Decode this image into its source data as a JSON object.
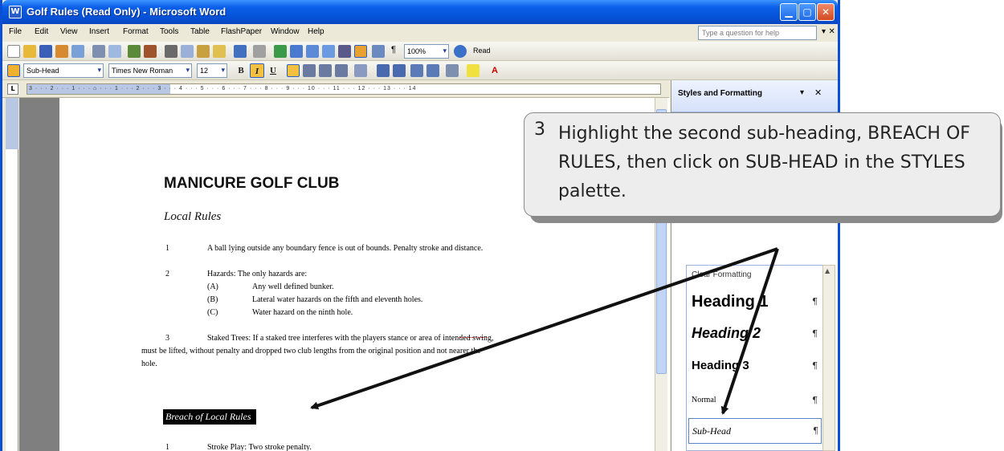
{
  "window": {
    "title": "Golf Rules (Read Only) - Microsoft Word",
    "icon_glyph": "W"
  },
  "menu": {
    "items": [
      "File",
      "Edit",
      "View",
      "Insert",
      "Format",
      "Tools",
      "Table",
      "FlashPaper",
      "Window",
      "Help"
    ],
    "help_placeholder": "Type a question for help"
  },
  "standard_toolbar": {
    "zoom": "100%",
    "read_label": "Read"
  },
  "formatting_toolbar": {
    "style": "Sub-Head",
    "font": "Times New Roman",
    "size": "12",
    "bold": "B",
    "italic": "I",
    "underline": "U",
    "font_color_label": "A"
  },
  "ruler": {
    "ticks": "3 · · · 2 · · · 1 · · · ⌂ · · · 1 · · · 2 · · · 3 · · · 4 · · · 5 · · · 6 · · · 7 · · · 8 · · · 9 · · · 10 · · · 11 · · · 12 · · · 13 · · · 14"
  },
  "document": {
    "title": "MANICURE GOLF CLUB",
    "subtitle": "Local Rules",
    "rule1": {
      "num": "1",
      "text": "A ball lying outside any boundary fence is out of bounds.  Penalty stroke and distance."
    },
    "rule2": {
      "num": "2",
      "text": "Hazards:  The only hazards are:",
      "sub": [
        {
          "label": "(A)",
          "text": "Any well defined bunker."
        },
        {
          "label": "(B)",
          "text": "Lateral water hazards on the fifth and eleventh holes."
        },
        {
          "label": "(C)",
          "text": "Water hazard on the ninth hole."
        }
      ]
    },
    "rule3": {
      "num": "3",
      "line1": "Staked Trees:  If a staked tree interferes with the players stance or area of intended swing,",
      "line2": "must be lifted, without penalty and dropped two club lengths from the original position and not nearer the",
      "line3": "hole."
    },
    "highlighted_heading": "Breach of Local Rules",
    "stroke_play": {
      "num": "1",
      "text": "Stroke Play:  Two stroke penalty."
    }
  },
  "styles_pane": {
    "title": "Styles and Formatting",
    "clear_formatting": "Clear Formatting",
    "heading1": "Heading 1",
    "heading2": "Heading 2",
    "heading3": "Heading 3",
    "normal": "Normal",
    "subhead": "Sub-Head",
    "para_mark": "¶",
    "selected_style": "Sub-Head"
  },
  "callout": {
    "step": "3",
    "text": "Highlight the second sub-heading, BREACH OF RULES, then click on SUB-HEAD in the STYLES palette."
  },
  "colors": {
    "titlebar": "#0653d8",
    "chrome": "#ece9d8",
    "callout_bg": "#ededed",
    "highlight": "#000000"
  }
}
